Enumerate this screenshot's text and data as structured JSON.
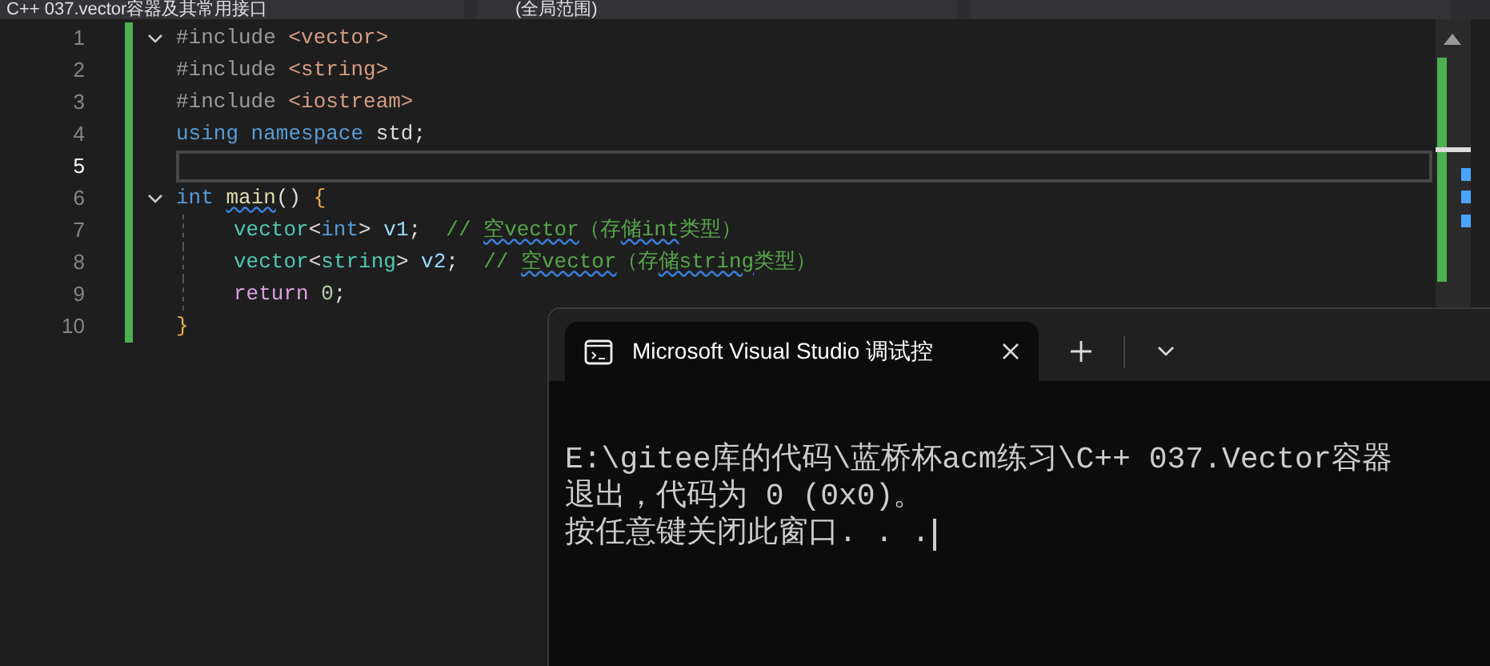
{
  "nav_bar": {
    "file_scope": "C++ 037.vector容器及其常用接口",
    "member_scope": "(全局范围)"
  },
  "editor": {
    "lines": [
      {
        "number": "1",
        "fold": true,
        "current": false,
        "indented": false,
        "tokens": [
          {
            "text": "#include ",
            "kind": "pre"
          },
          {
            "text": "<vector>",
            "kind": "inc"
          }
        ]
      },
      {
        "number": "2",
        "fold": false,
        "current": false,
        "indented": false,
        "tokens": [
          {
            "text": "#include ",
            "kind": "pre"
          },
          {
            "text": "<string>",
            "kind": "inc"
          }
        ]
      },
      {
        "number": "3",
        "fold": false,
        "current": false,
        "indented": false,
        "tokens": [
          {
            "text": "#include ",
            "kind": "pre"
          },
          {
            "text": "<iostream>",
            "kind": "inc"
          }
        ]
      },
      {
        "number": "4",
        "fold": false,
        "current": false,
        "indented": false,
        "tokens": [
          {
            "text": "using namespace",
            "kind": "kw"
          },
          {
            "text": " std;",
            "kind": "plain"
          }
        ]
      },
      {
        "number": "5",
        "fold": false,
        "current": true,
        "indented": false
      },
      {
        "number": "6",
        "fold": true,
        "current": false,
        "indented": false,
        "tokens": [
          {
            "text": "int ",
            "kind": "kw"
          },
          {
            "text": "main",
            "kind": "fn",
            "squiggle": true
          },
          {
            "text": "()",
            "kind": "plain"
          },
          {
            "text": " {",
            "kind": "brace"
          }
        ]
      },
      {
        "number": "7",
        "fold": false,
        "current": false,
        "indented": true,
        "tokens": [
          {
            "text": "vector",
            "kind": "type"
          },
          {
            "text": "<",
            "kind": "plain"
          },
          {
            "text": "int",
            "kind": "kw"
          },
          {
            "text": "> ",
            "kind": "plain"
          },
          {
            "text": "v1",
            "kind": "var"
          },
          {
            "text": ";  ",
            "kind": "plain"
          },
          {
            "text": "// ",
            "kind": "cmt"
          },
          {
            "text": "空vector",
            "kind": "cmt",
            "squiggle": true
          },
          {
            "text": "（存",
            "kind": "cmt"
          },
          {
            "text": "储int",
            "kind": "cmt",
            "squiggle": true
          },
          {
            "text": "类型）",
            "kind": "cmt"
          }
        ]
      },
      {
        "number": "8",
        "fold": false,
        "current": false,
        "indented": true,
        "tokens": [
          {
            "text": "vector",
            "kind": "type"
          },
          {
            "text": "<",
            "kind": "plain"
          },
          {
            "text": "string",
            "kind": "type"
          },
          {
            "text": "> ",
            "kind": "plain"
          },
          {
            "text": "v2",
            "kind": "var"
          },
          {
            "text": ";  ",
            "kind": "plain"
          },
          {
            "text": "// ",
            "kind": "cmt"
          },
          {
            "text": "空vector",
            "kind": "cmt",
            "squiggle": true
          },
          {
            "text": "（存",
            "kind": "cmt"
          },
          {
            "text": "储string",
            "kind": "cmt",
            "squiggle": true
          },
          {
            "text": "类型）",
            "kind": "cmt"
          }
        ]
      },
      {
        "number": "9",
        "fold": false,
        "current": false,
        "indented": true,
        "tokens": [
          {
            "text": "return ",
            "kind": "ctl"
          },
          {
            "text": "0",
            "kind": "num"
          },
          {
            "text": ";",
            "kind": "plain"
          }
        ]
      },
      {
        "number": "10",
        "fold": false,
        "current": false,
        "indented": false,
        "tokens": [
          {
            "text": "}",
            "kind": "brace"
          }
        ]
      }
    ]
  },
  "console": {
    "tabs": [
      {
        "title": "Microsoft Visual Studio 调试控",
        "selected": true
      }
    ],
    "lines": [
      "E:\\gitee库的代码\\蓝桥杯acm练习\\C++ 037.Vector容器",
      "退出，代码为 0 (0x0)。",
      "按任意键关闭此窗口. . ."
    ]
  }
}
